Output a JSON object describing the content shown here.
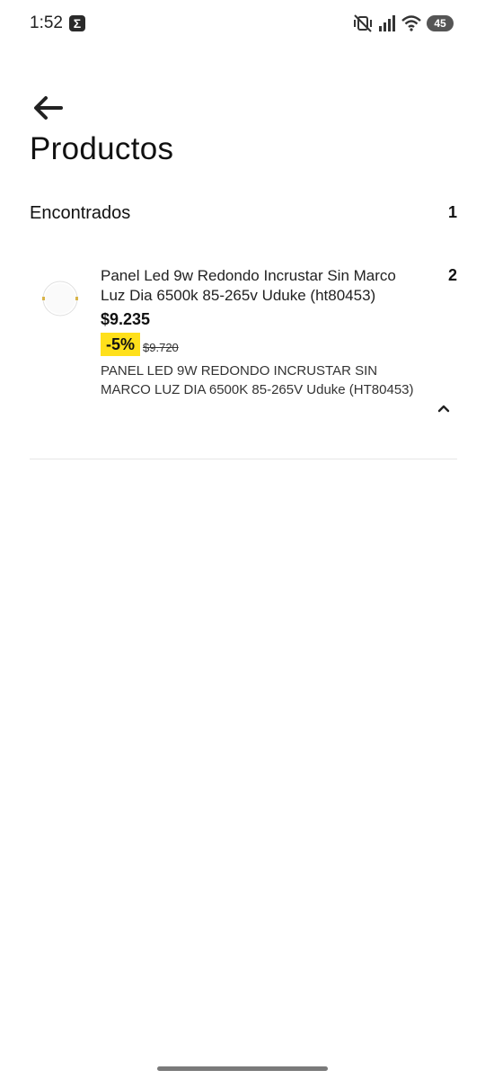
{
  "status_bar": {
    "time": "1:52",
    "app_indicator": "Σ",
    "battery": "45",
    "icons": [
      "vibrate-off-icon",
      "signal-icon",
      "wifi-icon",
      "battery-icon"
    ]
  },
  "header": {
    "back_icon": "arrow-left-icon",
    "title": "Productos"
  },
  "section": {
    "label": "Encontrados",
    "count": "1"
  },
  "products": [
    {
      "name": "Panel Led 9w Redondo Incrustar Sin Marco Luz Dia 6500k 85-265v Uduke (ht80453)",
      "price": "$9.235",
      "discount": "-5%",
      "old_price": "$9.720",
      "description": "PANEL LED 9W REDONDO INCRUSTAR SIN MARCO LUZ DIA 6500K 85-265V Uduke (HT80453)",
      "quantity": "2",
      "expand_icon": "chevron-up-icon"
    }
  ],
  "colors": {
    "discount_badge": "#ffe01b",
    "text": "#111111",
    "divider": "#e6e6e6"
  }
}
